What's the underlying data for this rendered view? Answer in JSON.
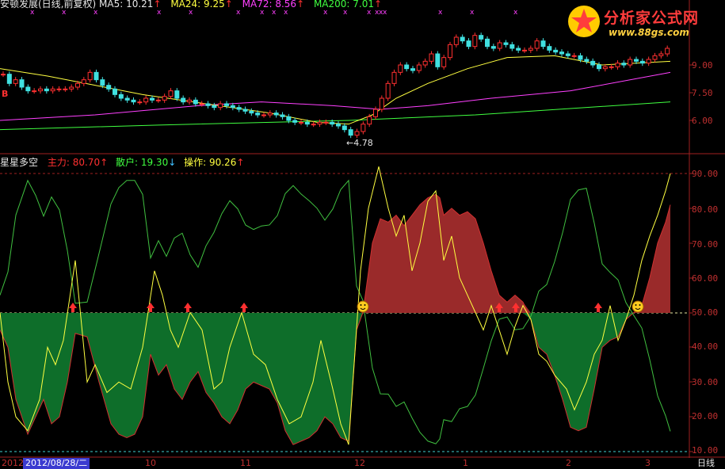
{
  "main_panel": {
    "stock_title": "安顿发展(日线,前复权)",
    "ma_labels": [
      {
        "name": "MA5",
        "value": "10.21",
        "arrow": "↑",
        "color": "#e6e6e6"
      },
      {
        "name": "MA24",
        "value": "9.25",
        "arrow": "↑",
        "color": "#ffff40"
      },
      {
        "name": "MA72",
        "value": "8.56",
        "arrow": "↑",
        "color": "#ff40ff"
      },
      {
        "name": "MA200",
        "value": "7.01",
        "arrow": "↑",
        "color": "#40ff40"
      }
    ],
    "y_ticks": [
      "9.00",
      "7.50",
      "6.00"
    ],
    "low_label": "4.78",
    "buy_marker": "B"
  },
  "indicator_panel": {
    "title": "星星多空",
    "labels": [
      {
        "name": "主力",
        "value": "80.70",
        "arrow": "↑",
        "color": "#ff3030"
      },
      {
        "name": "散户",
        "value": "19.30",
        "arrow": "↓",
        "color": "#40ff40"
      },
      {
        "name": "操作",
        "value": "90.26",
        "arrow": "↑",
        "color": "#ffff40"
      }
    ],
    "y_ticks": [
      "90.00",
      "80.00",
      "70.00",
      "60.00",
      "50.00",
      "40.00",
      "30.00",
      "20.00",
      "10.00"
    ]
  },
  "x_axis": {
    "start_label": "2012",
    "date_box": "2012/08/28/二",
    "month_labels": [
      "10",
      "11",
      "12",
      "1",
      "2",
      "3"
    ],
    "period": "日线"
  },
  "watermark": {
    "title": "分析家公式网",
    "url": "www.88gs.com"
  },
  "colors": {
    "up": "#ff3030",
    "down": "#40e0e0",
    "main_force_fill": "#9a2a2a",
    "retail_fill": "#0e6e2a",
    "operate_line": "#ffff40",
    "retail_line": "#40c040"
  }
}
